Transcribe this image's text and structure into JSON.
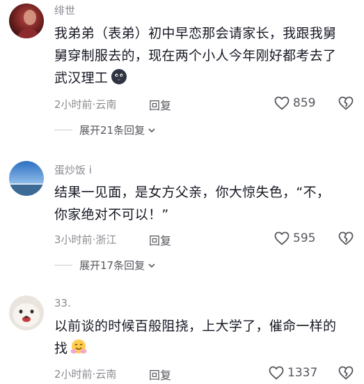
{
  "comments": [
    {
      "username": "绯世",
      "lines": [
        "我弟弟（表弟）初中早恋那会请家长，我跟我舅",
        "舅穿制服去的，现在两个小人今年刚好都考去了",
        "武汉理工"
      ],
      "emoji": "black-blob-emoji",
      "time": "2小时前",
      "location": "云南",
      "reply_label": "回复",
      "likes": "859",
      "expand_label": "展开21条回复",
      "avatar_colors": [
        "#3a1212",
        "#b23a3a"
      ]
    },
    {
      "username": "蛋炒饭 i",
      "lines": [
        "结果一见面，是女方父亲，你大惊失色，“不，",
        "你家绝对不可以！”"
      ],
      "time": "3小时前",
      "location": "浙江",
      "reply_label": "回复",
      "likes": "595",
      "expand_label": "展开17条回复",
      "avatar_colors": [
        "#2f6fbf",
        "#a9c7e6"
      ]
    },
    {
      "username": "33.",
      "lines": [
        "以前谈的时候百般阻挠，上大学了，催命一样的",
        "找"
      ],
      "emoji": "hugging-face-emoji",
      "time": "2小时前",
      "location": "云南",
      "reply_label": "回复",
      "likes": "1337",
      "avatar_colors": [
        "#d9d4cc",
        "#f3efe9"
      ]
    }
  ],
  "meta_separator": "·",
  "colors": {
    "text": "#161823",
    "secondary": "#8a8b91",
    "action": "#55565c"
  }
}
